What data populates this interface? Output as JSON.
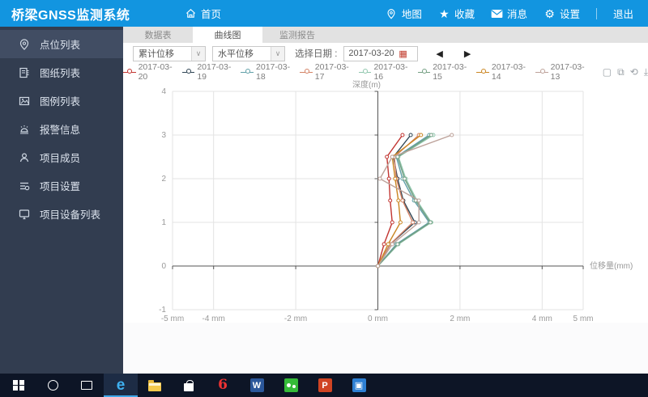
{
  "header": {
    "title": "桥梁GNSS监测系统",
    "home": {
      "icon": "home-icon",
      "label": "首页"
    },
    "actions": [
      {
        "icon": "map-pin-icon",
        "label": "地图"
      },
      {
        "icon": "star-icon",
        "label": "收藏"
      },
      {
        "icon": "mail-icon",
        "label": "消息"
      },
      {
        "icon": "gear-icon",
        "label": "设置"
      }
    ],
    "logout": "退出"
  },
  "sidebar": {
    "items": [
      {
        "icon": "location-pin-icon",
        "label": "点位列表",
        "active": true
      },
      {
        "icon": "drawing-sheet-icon",
        "label": "图纸列表",
        "active": false
      },
      {
        "icon": "image-legend-icon",
        "label": "图例列表",
        "active": false
      },
      {
        "icon": "alarm-icon",
        "label": "报警信息",
        "active": false
      },
      {
        "icon": "member-icon",
        "label": "项目成员",
        "active": false
      },
      {
        "icon": "project-settings-icon",
        "label": "项目设置",
        "active": false
      },
      {
        "icon": "device-list-icon",
        "label": "项目设备列表",
        "active": false
      }
    ]
  },
  "tabs": [
    {
      "label": "数据表",
      "active": false
    },
    {
      "label": "曲线图",
      "active": true
    },
    {
      "label": "监测报告",
      "active": false
    }
  ],
  "controls": {
    "select_displacement_type": "累计位移",
    "select_direction": "水平位移",
    "date_label": "选择日期 :",
    "date_value": "2017-03-20",
    "prev_icon": "prev-arrow-icon",
    "next_icon": "next-arrow-icon",
    "calendar_icon": "calendar-icon"
  },
  "toolbox": [
    {
      "icon": "box-zoom-icon"
    },
    {
      "icon": "zoom-reset-icon"
    },
    {
      "icon": "refresh-icon"
    },
    {
      "icon": "download-icon"
    }
  ],
  "chart_data": {
    "type": "line",
    "title": "深度(m)",
    "xlabel": "位移量(mm)",
    "ylabel": "深度(m)",
    "xlim": [
      -5,
      5
    ],
    "ylim": [
      -1,
      4
    ],
    "grid": true,
    "legend_position": "top",
    "x_ticks": [
      {
        "value": -5,
        "label": "-5 mm"
      },
      {
        "value": -4,
        "label": "-4 mm"
      },
      {
        "value": -2,
        "label": "-2 mm"
      },
      {
        "value": 0,
        "label": "0 mm"
      },
      {
        "value": 2,
        "label": "2 mm"
      },
      {
        "value": 4,
        "label": "4 mm"
      },
      {
        "value": 5,
        "label": "5 mm"
      }
    ],
    "y_ticks": [
      {
        "value": 4,
        "label": "4"
      },
      {
        "value": 3,
        "label": "3"
      },
      {
        "value": 2,
        "label": "2"
      },
      {
        "value": 1,
        "label": "1"
      },
      {
        "value": 0,
        "label": "0"
      },
      {
        "value": -1,
        "label": "-1"
      }
    ],
    "depths": [
      0,
      0.5,
      1,
      1.5,
      2,
      2.5,
      3
    ],
    "series": [
      {
        "name": "2017-03-20",
        "color": "#c23531",
        "values": [
          0,
          0.15,
          0.35,
          0.3,
          0.27,
          0.22,
          0.6
        ]
      },
      {
        "name": "2017-03-19",
        "color": "#2f4554",
        "values": [
          0,
          0.3,
          0.9,
          0.62,
          0.48,
          0.38,
          0.8
        ]
      },
      {
        "name": "2017-03-18",
        "color": "#61a0a8",
        "values": [
          0,
          0.45,
          1.25,
          0.88,
          0.6,
          0.45,
          1.25
        ]
      },
      {
        "name": "2017-03-17",
        "color": "#d48265",
        "values": [
          0,
          0.3,
          0.85,
          0.6,
          0.45,
          0.4,
          1.0
        ]
      },
      {
        "name": "2017-03-16",
        "color": "#91c7ae",
        "values": [
          0,
          0.5,
          1.3,
          0.95,
          0.68,
          0.5,
          1.35
        ]
      },
      {
        "name": "2017-03-15",
        "color": "#749f83",
        "values": [
          0,
          0.48,
          1.28,
          0.92,
          0.65,
          0.48,
          1.3
        ]
      },
      {
        "name": "2017-03-14",
        "color": "#ca8622",
        "values": [
          0,
          0.25,
          0.55,
          0.5,
          0.42,
          0.35,
          1.05
        ]
      },
      {
        "name": "2017-03-13",
        "color": "#bda29a",
        "values": [
          0,
          0.35,
          1.0,
          1.0,
          0.05,
          0.35,
          1.8
        ]
      }
    ]
  },
  "taskbar": {
    "icons": [
      {
        "name": "windows-start-icon",
        "active": false
      },
      {
        "name": "cortana-icon",
        "active": false
      },
      {
        "name": "task-view-icon",
        "active": false
      },
      {
        "name": "edge-browser-icon",
        "active": true
      },
      {
        "name": "file-explorer-icon",
        "active": false
      },
      {
        "name": "store-icon",
        "active": false
      },
      {
        "name": "browser-360-icon",
        "active": false
      },
      {
        "name": "word-icon",
        "active": false
      },
      {
        "name": "wechat-icon",
        "active": false
      },
      {
        "name": "powerpoint-icon",
        "active": false
      },
      {
        "name": "blue-app-icon",
        "active": false
      }
    ]
  },
  "colors": {
    "header_blue": "#1295e0",
    "sidebar_dark": "#323d50",
    "sidebar_active": "#414d63",
    "axis_dark": "#555555",
    "grid_light": "#e3e3e3",
    "taskbar_dark": "#0d1526"
  }
}
